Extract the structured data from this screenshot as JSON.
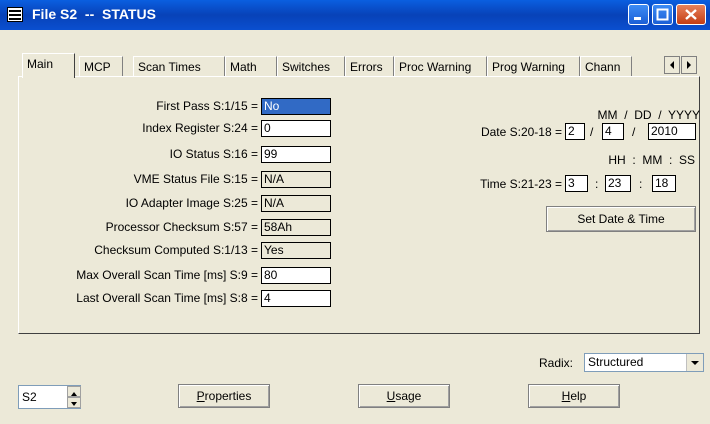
{
  "window": {
    "title": "File S2  --  STATUS"
  },
  "tabs": [
    "Main",
    "MCP",
    "Scan Times",
    "Math",
    "Switches",
    "Errors",
    "Proc Warning",
    "Prog Warning",
    "Chann"
  ],
  "main": {
    "fields": [
      {
        "label": "First Pass S:1/15 =",
        "value": "No"
      },
      {
        "label": "Index Register S:24 =",
        "value": "0"
      },
      {
        "label": "IO Status S:16 =",
        "value": "99"
      },
      {
        "label": "VME Status File S:15 =",
        "value": "N/A"
      },
      {
        "label": "IO Adapter Image S:25 =",
        "value": "N/A"
      },
      {
        "label": "Processor Checksum S:57 =",
        "value": "58Ah"
      },
      {
        "label": "Checksum Computed S:1/13 =",
        "value": "Yes"
      },
      {
        "label": "Max Overall Scan Time  [ms] S:9 =",
        "value": "80"
      },
      {
        "label": "Last Overall Scan Time  [ms] S:8 =",
        "value": "4"
      }
    ],
    "date": {
      "format_label": "MM  /  DD  /  YYYY",
      "label": "Date S:20-18 =",
      "month": "2",
      "day": "4",
      "year": "2010",
      "sep": "/"
    },
    "time": {
      "format_label": "HH  :  MM  :  SS",
      "label": "Time S:21-23 =",
      "hour": "3",
      "minute": "23",
      "second": "18",
      "sep": ":"
    },
    "set_button": "Set Date & Time"
  },
  "radix": {
    "label": "Radix:",
    "value": "Structured"
  },
  "file_spinner": {
    "value": "S2"
  },
  "buttons": {
    "properties": "Properties",
    "usage": "Usage",
    "help": "Help"
  },
  "colors": {
    "title_bar": "#0842b8",
    "selection": "#316ac5",
    "dialog_face": "#ece9d8"
  }
}
